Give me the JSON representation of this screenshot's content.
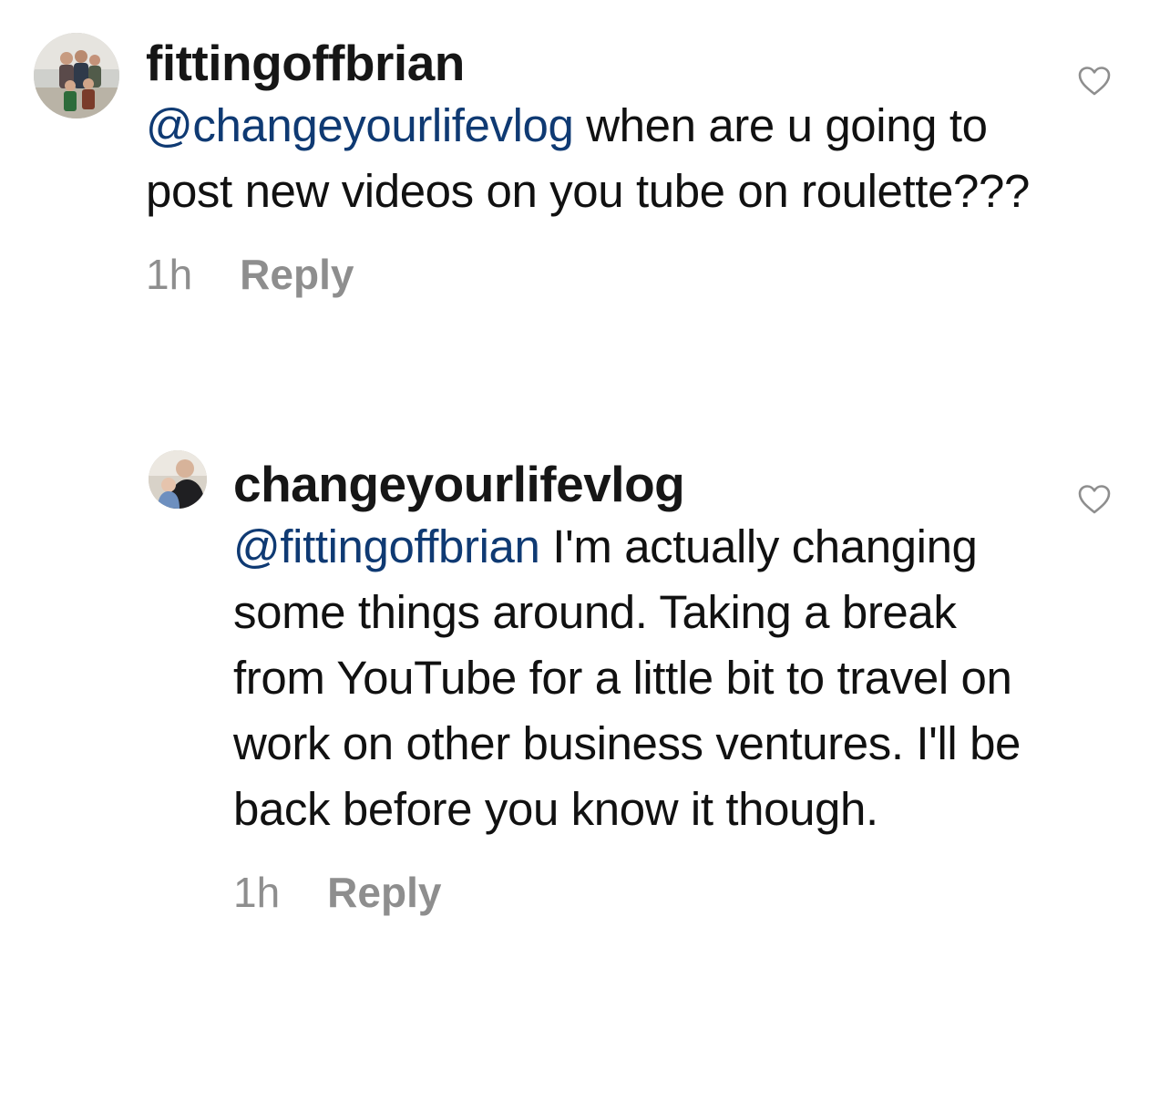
{
  "comments": [
    {
      "username": "fittingoffbrian",
      "mention": "@changeyourlifevlog",
      "text": " when are u going to post new videos on you tube on roulette???",
      "time": "1h",
      "reply_label": "Reply",
      "like_icon": "heart-outline-icon"
    },
    {
      "username": "changeyourlifevlog",
      "mention": "@fittingoffbrian",
      "text": " I'm actually changing some things around. Taking a break from YouTube for a little bit to travel on work on other business ventures. I'll be back before you know it though.",
      "time": "1h",
      "reply_label": "Reply",
      "like_icon": "heart-outline-icon"
    }
  ],
  "colors": {
    "mention": "#0f3a73",
    "meta": "#8e8e8e",
    "text": "#111111"
  }
}
